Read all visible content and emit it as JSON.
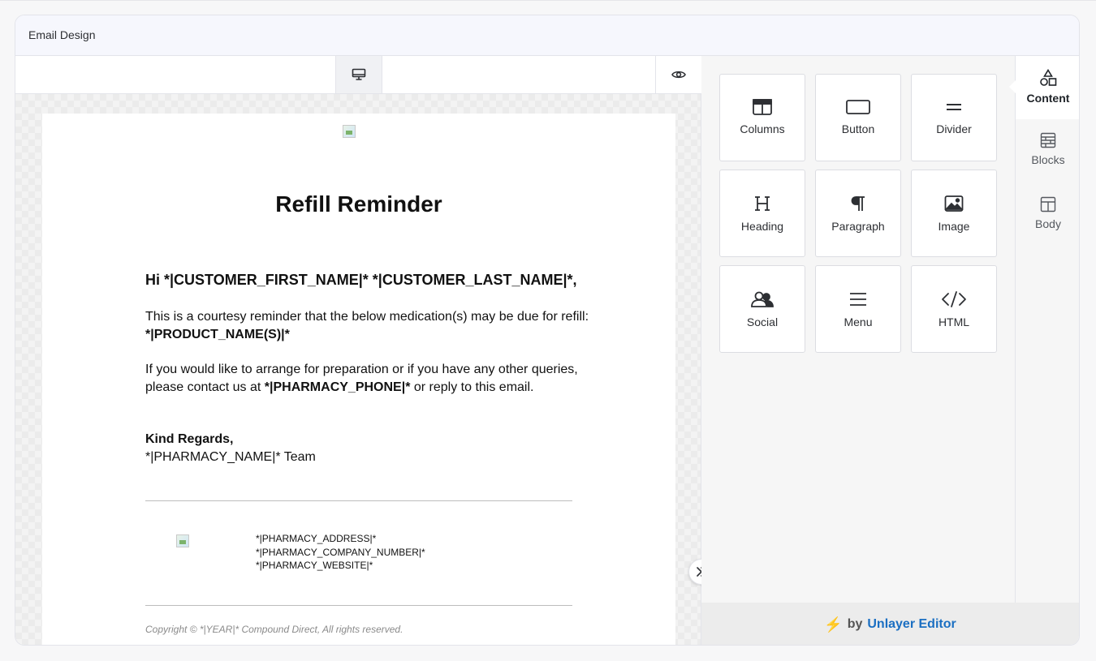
{
  "app": {
    "title": "Email Design"
  },
  "toolbar": {
    "desktop_icon": "desktop-monitor-icon",
    "preview_icon": "eye-icon"
  },
  "email": {
    "title": "Refill Reminder",
    "greeting": "Hi *|CUSTOMER_FIRST_NAME|* *|CUSTOMER_LAST_NAME|*,",
    "reminder_text": "This is a courtesy reminder that the below medication(s) may be due for refill:",
    "product_name": "*|PRODUCT_NAME(S)|*",
    "contact_text_1": "If you would like to arrange for preparation or if you have any other queries,",
    "contact_text_2": "please contact us at ",
    "pharmacy_phone": "*|PHARMACY_PHONE|*",
    "contact_text_3": " or reply to this email.",
    "sign_off": "Kind Regards,",
    "team": "*|PHARMACY_NAME|* Team",
    "footer_address": "*|PHARMACY_ADDRESS|*",
    "footer_company": "*|PHARMACY_COMPANY_NUMBER|*",
    "footer_website": "*|PHARMACY_WEBSITE|*",
    "copyright": "Copyright © *|YEAR|* Compound Direct, All rights reserved."
  },
  "tools": [
    {
      "label": "Columns",
      "icon": "columns-icon"
    },
    {
      "label": "Button",
      "icon": "button-icon"
    },
    {
      "label": "Divider",
      "icon": "divider-icon"
    },
    {
      "label": "Heading",
      "icon": "heading-icon"
    },
    {
      "label": "Paragraph",
      "icon": "paragraph-icon"
    },
    {
      "label": "Image",
      "icon": "image-icon"
    },
    {
      "label": "Social",
      "icon": "social-icon"
    },
    {
      "label": "Menu",
      "icon": "menu-icon"
    },
    {
      "label": "HTML",
      "icon": "html-code-icon"
    }
  ],
  "side_tabs": [
    {
      "label": "Content",
      "icon": "shapes-icon",
      "active": true
    },
    {
      "label": "Blocks",
      "icon": "blocks-icon"
    },
    {
      "label": "Body",
      "icon": "body-layout-icon"
    }
  ],
  "footer": {
    "by": "by",
    "brand": "Unlayer Editor"
  },
  "colors": {
    "brand_link": "#1b6fc2",
    "bolt": "#f0a830",
    "header_bg": "#f6f7fd"
  }
}
